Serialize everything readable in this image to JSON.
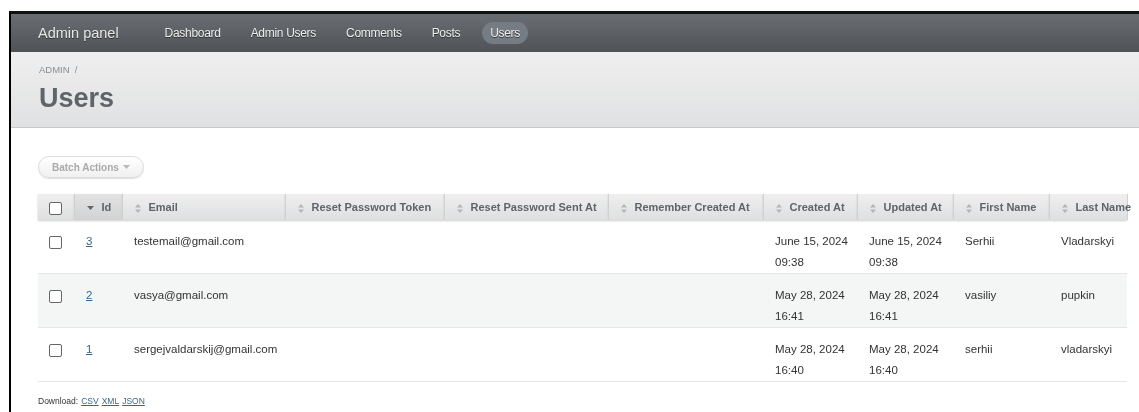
{
  "header": {
    "brand": "Admin panel",
    "nav": [
      {
        "label": "Dashboard",
        "selected": false
      },
      {
        "label": "Admin Users",
        "selected": false
      },
      {
        "label": "Comments",
        "selected": false
      },
      {
        "label": "Posts",
        "selected": false
      },
      {
        "label": "Users",
        "selected": true
      }
    ]
  },
  "breadcrumb": "ADMIN",
  "breadcrumb_separator": "/",
  "title": "Users",
  "batch_actions": {
    "label": "Batch Actions",
    "disabled": true
  },
  "table": {
    "select_all_checked": false,
    "columns": [
      {
        "label": "Id",
        "sorted": true
      },
      {
        "label": "Email",
        "sorted": false
      },
      {
        "label": "Reset Password Token",
        "sorted": false
      },
      {
        "label": "Reset Password Sent At",
        "sorted": false
      },
      {
        "label": "Remember Created At",
        "sorted": false
      },
      {
        "label": "Created At",
        "sorted": false
      },
      {
        "label": "Updated At",
        "sorted": false
      },
      {
        "label": "First Name",
        "sorted": false
      },
      {
        "label": "Last Name",
        "sorted": false
      }
    ],
    "rows": [
      {
        "checked": false,
        "cells": [
          "3",
          "testemail@gmail.com",
          "",
          "",
          "",
          "June 15, 2024 09:38",
          "June 15, 2024 09:38",
          "Serhii",
          "Vladarskyi"
        ]
      },
      {
        "checked": false,
        "cells": [
          "2",
          "vasya@gmail.com",
          "",
          "",
          "",
          "May 28, 2024 16:41",
          "May 28, 2024 16:41",
          "vasiliy",
          "pupkin"
        ]
      },
      {
        "checked": false,
        "cells": [
          "1",
          "sergejvaldarskij@gmail.com",
          "",
          "",
          "",
          "May 28, 2024 16:40",
          "May 28, 2024 16:40",
          "serhii",
          "vladarskyi"
        ]
      }
    ]
  },
  "download": {
    "label": "Download:",
    "formats": [
      "CSV",
      "XML",
      "JSON"
    ]
  }
}
